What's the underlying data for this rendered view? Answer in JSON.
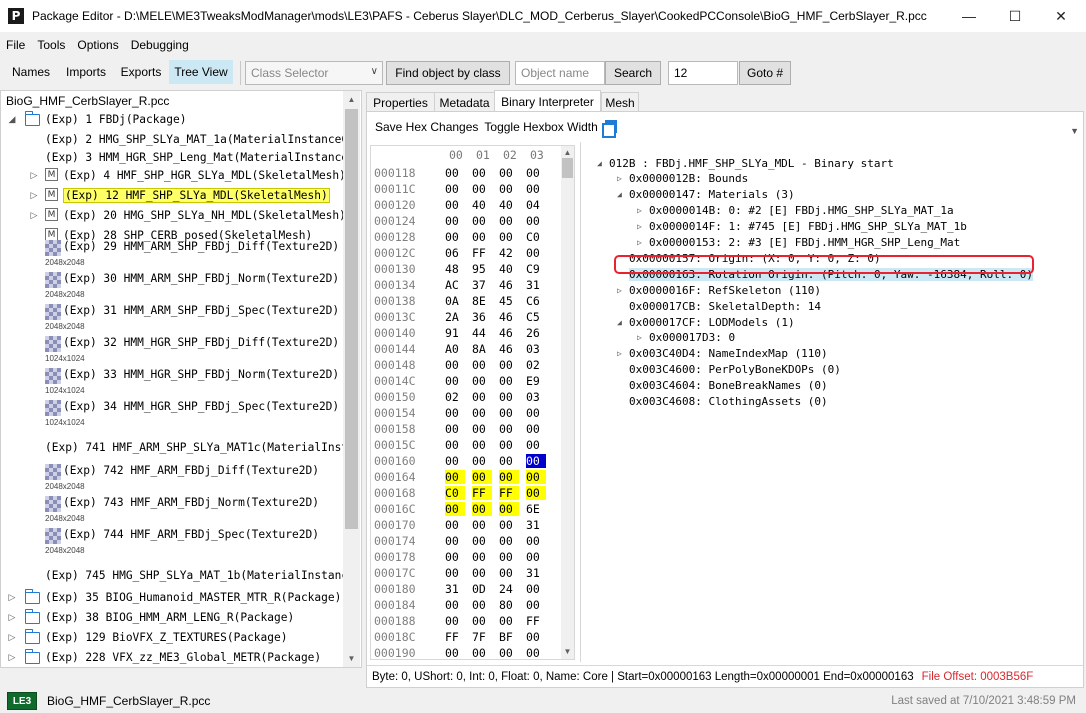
{
  "window": {
    "title": "Package Editor - D:\\MELE\\ME3TweaksModManager\\mods\\LE3\\PAFS - Ceberus Slayer\\DLC_MOD_Cerberus_Slayer\\CookedPCConsole\\BioG_HMF_CerbSlayer_R.pcc",
    "app_icon": "P"
  },
  "menu": [
    "File",
    "Tools",
    "Options",
    "Debugging"
  ],
  "toolbar": {
    "tabs": [
      "Names",
      "Imports",
      "Exports",
      "Tree View"
    ],
    "active_tab": "Tree View",
    "class_selector_placeholder": "Class Selector",
    "find_by_class_label": "Find object by class",
    "object_name_placeholder": "Object name",
    "search_label": "Search",
    "goto_value": "12",
    "goto_label": "Goto #"
  },
  "tree": {
    "root": "BioG_HMF_CerbSlayer_R.pcc",
    "items": [
      {
        "text": "(Exp) 1 FBDj(Package)",
        "icon": "folder-icon",
        "expander": "open"
      },
      {
        "text": "(Exp) 2 HMG_SHP_SLYa_MAT_1a(MaterialInstanceCo",
        "icon": "",
        "expander": ""
      },
      {
        "text": "(Exp) 3 HMM_HGR_SHP_Leng_Mat(MaterialInstanceC",
        "icon": "",
        "expander": ""
      },
      {
        "text": "(Exp) 4 HMF_SHP_HGR_SLYa_MDL(SkeletalMesh)",
        "icon": "mesh-icon",
        "expander": "closed"
      },
      {
        "text": "(Exp) 12 HMF_SHP_SLYa_MDL(SkeletalMesh)",
        "icon": "mesh-icon",
        "expander": "closed",
        "selected": true
      },
      {
        "text": "(Exp) 20 HMG_SHP_SLYa_NH_MDL(SkeletalMesh)",
        "icon": "mesh-icon",
        "expander": "closed"
      },
      {
        "text": "(Exp) 28 SHP_CERB_posed(SkeletalMesh)",
        "icon": "mesh-icon",
        "expander": ""
      },
      {
        "text": "(Exp) 29 HMM_ARM_SHP_FBDj_Diff(Texture2D)",
        "icon": "texture-icon",
        "size": "2048x2048"
      },
      {
        "text": "(Exp) 30 HMM_ARM_SHP_FBDj_Norm(Texture2D)",
        "icon": "texture-icon",
        "size": "2048x2048"
      },
      {
        "text": "(Exp) 31 HMM_ARM_SHP_FBDj_Spec(Texture2D)",
        "icon": "texture-icon",
        "size": "2048x2048"
      },
      {
        "text": "(Exp) 32 HMM_HGR_SHP_FBDj_Diff(Texture2D)",
        "icon": "texture-icon",
        "size": "1024x1024"
      },
      {
        "text": "(Exp) 33 HMM_HGR_SHP_FBDj_Norm(Texture2D)",
        "icon": "texture-icon",
        "size": "1024x1024"
      },
      {
        "text": "(Exp) 34 HMM_HGR_SHP_FBDj_Spec(Texture2D)",
        "icon": "texture-icon",
        "size": "1024x1024"
      },
      {
        "text": "(Exp) 741 HMF_ARM_SHP_SLYa_MAT1c(MaterialInsta",
        "icon": ""
      },
      {
        "text": "(Exp) 742 HMF_ARM_FBDj_Diff(Texture2D)",
        "icon": "texture-icon",
        "size": "2048x2048"
      },
      {
        "text": "(Exp) 743 HMF_ARM_FBDj_Norm(Texture2D)",
        "icon": "texture-icon",
        "size": "2048x2048"
      },
      {
        "text": "(Exp) 744 HMF_ARM_FBDj_Spec(Texture2D)",
        "icon": "texture-icon",
        "size": "2048x2048"
      },
      {
        "text": "(Exp) 745 HMG_SHP_SLYa_MAT_1b(MaterialInstanc",
        "icon": ""
      },
      {
        "text": "(Exp) 35 BIOG_Humanoid_MASTER_MTR_R(Package)",
        "icon": "folder-icon",
        "expander": "closed"
      },
      {
        "text": "(Exp) 38 BIOG_HMM_ARM_LENG_R(Package)",
        "icon": "folder-icon",
        "expander": "closed"
      },
      {
        "text": "(Exp) 129 BioVFX_Z_TEXTURES(Package)",
        "icon": "folder-icon",
        "expander": "closed"
      },
      {
        "text": "(Exp) 228 VFX_zz_ME3_Global_METR(Package)",
        "icon": "folder-icon",
        "expander": "closed"
      },
      {
        "text": "(Exp) 275 BioVFX_Env_Fire(Package)",
        "icon": "folder-icon",
        "expander": "closed"
      }
    ]
  },
  "panel_tabs": [
    "Properties",
    "Metadata",
    "Binary Interpreter",
    "Mesh"
  ],
  "active_panel_tab": "Binary Interpreter",
  "panel_tools": {
    "save_hex_label": "Save Hex Changes",
    "toggle_hexbox_label": "Toggle Hexbox Width"
  },
  "hex": {
    "header": [
      "00",
      "01",
      "02",
      "03"
    ],
    "rows": [
      {
        "offset": "000118",
        "bytes": [
          "00",
          "00",
          "00",
          "00"
        ]
      },
      {
        "offset": "00011C",
        "bytes": [
          "00",
          "00",
          "00",
          "00"
        ]
      },
      {
        "offset": "000120",
        "bytes": [
          "00",
          "40",
          "40",
          "04"
        ]
      },
      {
        "offset": "000124",
        "bytes": [
          "00",
          "00",
          "00",
          "00"
        ]
      },
      {
        "offset": "000128",
        "bytes": [
          "00",
          "00",
          "00",
          "C0"
        ]
      },
      {
        "offset": "00012C",
        "bytes": [
          "06",
          "FF",
          "42",
          "00"
        ]
      },
      {
        "offset": "000130",
        "bytes": [
          "48",
          "95",
          "40",
          "C9"
        ]
      },
      {
        "offset": "000134",
        "bytes": [
          "AC",
          "37",
          "46",
          "31"
        ]
      },
      {
        "offset": "000138",
        "bytes": [
          "0A",
          "8E",
          "45",
          "C6"
        ]
      },
      {
        "offset": "00013C",
        "bytes": [
          "2A",
          "36",
          "46",
          "C5"
        ]
      },
      {
        "offset": "000140",
        "bytes": [
          "91",
          "44",
          "46",
          "26"
        ]
      },
      {
        "offset": "000144",
        "bytes": [
          "A0",
          "8A",
          "46",
          "03"
        ]
      },
      {
        "offset": "000148",
        "bytes": [
          "00",
          "00",
          "00",
          "02"
        ]
      },
      {
        "offset": "00014C",
        "bytes": [
          "00",
          "00",
          "00",
          "E9"
        ]
      },
      {
        "offset": "000150",
        "bytes": [
          "02",
          "00",
          "00",
          "03"
        ]
      },
      {
        "offset": "000154",
        "bytes": [
          "00",
          "00",
          "00",
          "00"
        ]
      },
      {
        "offset": "000158",
        "bytes": [
          "00",
          "00",
          "00",
          "00"
        ]
      },
      {
        "offset": "00015C",
        "bytes": [
          "00",
          "00",
          "00",
          "00"
        ]
      },
      {
        "offset": "000160",
        "bytes": [
          "00",
          "00",
          "00",
          "00"
        ],
        "sel": [
          3
        ]
      },
      {
        "offset": "000164",
        "bytes": [
          "00",
          "00",
          "00",
          "00"
        ],
        "yel": [
          0,
          1,
          2,
          3
        ]
      },
      {
        "offset": "000168",
        "bytes": [
          "C0",
          "FF",
          "FF",
          "00"
        ],
        "yel": [
          0,
          1,
          2,
          3
        ]
      },
      {
        "offset": "00016C",
        "bytes": [
          "00",
          "00",
          "00",
          "6E"
        ],
        "yel": [
          0,
          1,
          2
        ]
      },
      {
        "offset": "000170",
        "bytes": [
          "00",
          "00",
          "00",
          "31"
        ]
      },
      {
        "offset": "000174",
        "bytes": [
          "00",
          "00",
          "00",
          "00"
        ]
      },
      {
        "offset": "000178",
        "bytes": [
          "00",
          "00",
          "00",
          "00"
        ]
      },
      {
        "offset": "00017C",
        "bytes": [
          "00",
          "00",
          "00",
          "31"
        ]
      },
      {
        "offset": "000180",
        "bytes": [
          "31",
          "0D",
          "24",
          "00"
        ]
      },
      {
        "offset": "000184",
        "bytes": [
          "00",
          "00",
          "80",
          "00"
        ]
      },
      {
        "offset": "000188",
        "bytes": [
          "00",
          "00",
          "00",
          "FF"
        ]
      },
      {
        "offset": "00018C",
        "bytes": [
          "FF",
          "7F",
          "BF",
          "00"
        ]
      },
      {
        "offset": "000190",
        "bytes": [
          "00",
          "00",
          "00",
          "00"
        ]
      }
    ]
  },
  "interpreter": [
    {
      "text": "012B : FBDj.HMF_SHP_SLYa_MDL - Binary start",
      "depth": 0,
      "expander": "open"
    },
    {
      "text": "0x0000012B: Bounds",
      "depth": 1,
      "expander": "closed"
    },
    {
      "text": "0x00000147: Materials (3)",
      "depth": 1,
      "expander": "open"
    },
    {
      "text": "0x0000014B: 0: #2 [E] FBDj.HMG_SHP_SLYa_MAT_1a",
      "depth": 2,
      "expander": "closed"
    },
    {
      "text": "0x0000014F: 1: #745 [E] FBDj.HMG_SHP_SLYa_MAT_1b",
      "depth": 2,
      "expander": "closed"
    },
    {
      "text": "0x00000153: 2: #3 [E] FBDj.HMM_HGR_SHP_Leng_Mat",
      "depth": 2,
      "expander": "closed"
    },
    {
      "text": "0x00000157: Origin: (X: 0, Y: 0, Z: 0)",
      "depth": 1,
      "expander": ""
    },
    {
      "text": "0x00000163: Rotation Origin: (Pitch: 0, Yaw: -16384, Roll: 0)",
      "depth": 1,
      "expander": "",
      "selected": true
    },
    {
      "text": "0x0000016F: RefSkeleton (110)",
      "depth": 1,
      "expander": "closed"
    },
    {
      "text": "0x000017CB: SkeletalDepth: 14",
      "depth": 1,
      "expander": ""
    },
    {
      "text": "0x000017CF: LODModels (1)",
      "depth": 1,
      "expander": "open"
    },
    {
      "text": "0x000017D3: 0",
      "depth": 2,
      "expander": "closed"
    },
    {
      "text": "0x003C40D4: NameIndexMap (110)",
      "depth": 1,
      "expander": "closed"
    },
    {
      "text": "0x003C4600: PerPolyBoneKDOPs (0)",
      "depth": 1,
      "expander": ""
    },
    {
      "text": "0x003C4604: BoneBreakNames (0)",
      "depth": 1,
      "expander": ""
    },
    {
      "text": "0x003C4608: ClothingAssets (0)",
      "depth": 1,
      "expander": ""
    }
  ],
  "status": {
    "text": "Byte: 0, UShort: 0, Int: 0, Float: 0, Name: Core | Start=0x00000163 Length=0x00000001 End=0x00000163",
    "file_offset": "File Offset: 0003B56F"
  },
  "bottom": {
    "badge": "LE3",
    "file": "BioG_HMF_CerbSlayer_R.pcc",
    "last_saved": "Last saved at 7/10/2021 3:48:59 PM"
  },
  "colors": {
    "accent": "#cce8f4",
    "highlight_yellow": "#ffff00",
    "hex_selection": "#0000cc",
    "callout_red": "#e8232f",
    "badge_green": "#0f6a2b"
  }
}
